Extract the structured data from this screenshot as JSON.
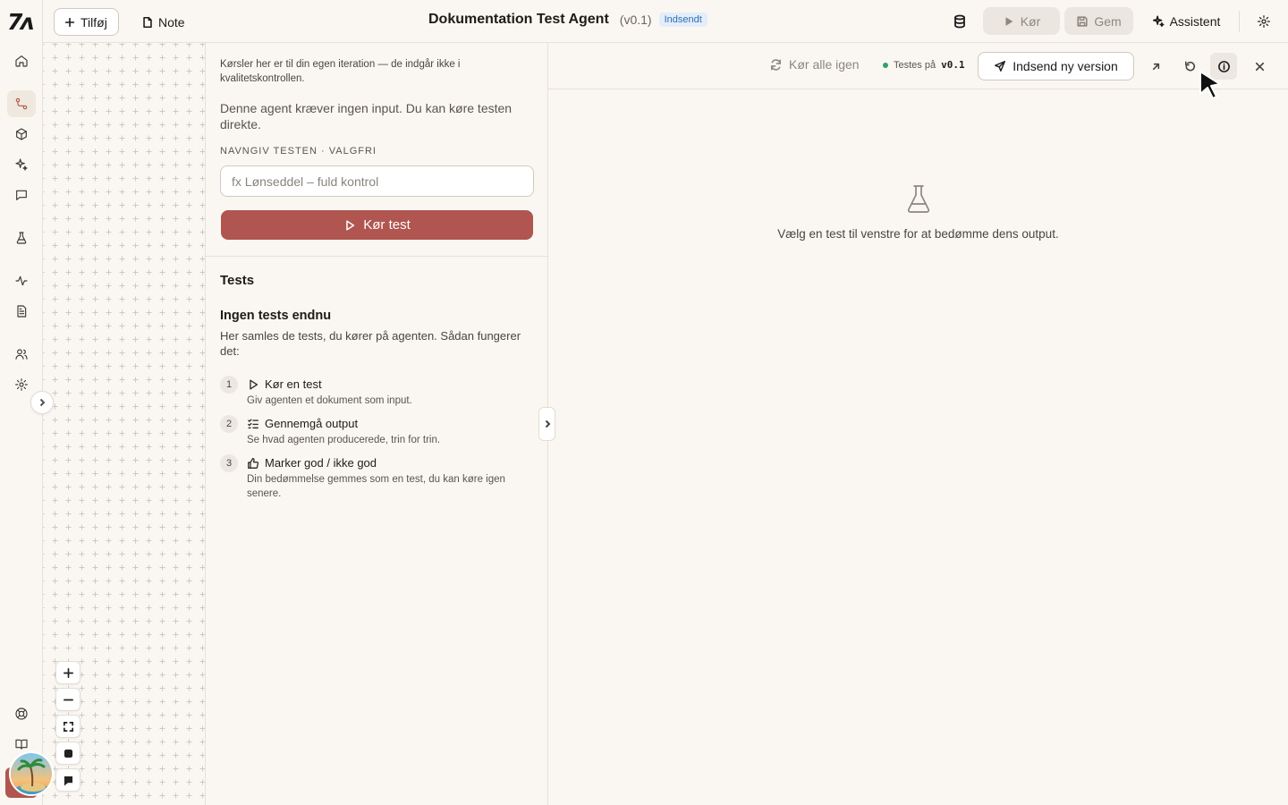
{
  "app": {
    "logo_text": "7ʌ",
    "title": "Dokumentation Test Agent",
    "version": "(v0.1)",
    "status_badge": "Indsendt"
  },
  "toolbar": {
    "add_label": "Tilføj",
    "note_label": "Note",
    "run_label": "Kør",
    "save_label": "Gem",
    "assistant_label": "Assistent"
  },
  "sidebar": {
    "items": [
      {
        "icon": "home-icon"
      },
      {
        "icon": "workflow-icon",
        "active": true
      },
      {
        "icon": "box-icon"
      },
      {
        "icon": "sparkle-icon"
      },
      {
        "icon": "chat-icon"
      },
      {
        "icon": "flask-icon"
      },
      {
        "icon": "activity-icon"
      },
      {
        "icon": "document-icon"
      },
      {
        "icon": "users-icon"
      },
      {
        "icon": "settings-icon"
      }
    ],
    "bottom": [
      {
        "icon": "help-icon"
      },
      {
        "icon": "book-icon"
      }
    ]
  },
  "panel": {
    "iteration_note": "Kørsler her er til din egen iteration — de indgår ikke i kvalitetskontrollen.",
    "no_input_note": "Denne agent kræver ingen input. Du kan køre testen direkte.",
    "name_label": "NAVNGIV TESTEN · VALGFRI",
    "name_placeholder": "fx Lønseddel – fuld kontrol",
    "name_value": "",
    "run_test_label": "Kør test",
    "tests_heading": "Tests",
    "empty_title": "Ingen tests endnu",
    "empty_desc": "Her samles de tests, du kører på agenten. Sådan fungerer det:",
    "steps": [
      {
        "num": "1",
        "title": "Kør en test",
        "desc": "Giv agenten et dokument som input."
      },
      {
        "num": "2",
        "title": "Gennemgå output",
        "desc": "Se hvad agenten producerede, trin for trin."
      },
      {
        "num": "3",
        "title": "Marker god / ikke god",
        "desc": "Din bedømmelse gemmes som en test, du kan køre igen senere."
      }
    ]
  },
  "right": {
    "rerun_all_label": "Kør alle igen",
    "testing_on_label": "Testes på",
    "testing_version": "v0.1",
    "submit_label": "Indsend ny version",
    "empty_text": "Vælg en test til venstre for at bedømme dens output."
  },
  "colors": {
    "accent": "#b0554f",
    "status_green": "#2ea46a",
    "badge_blue": "#2f6fb0",
    "background": "#faf7f2"
  }
}
